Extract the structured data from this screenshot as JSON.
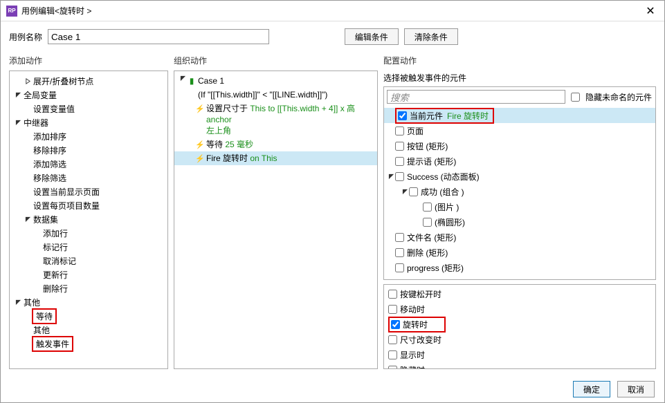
{
  "window": {
    "title": "用例编辑<旋转时 >"
  },
  "top": {
    "name_label": "用例名称",
    "name_value": "Case 1",
    "edit_condition": "编辑条件",
    "clear_condition": "清除条件"
  },
  "panels": {
    "left_title": "添加动作",
    "mid_title": "组织动作",
    "right_title": "配置动作"
  },
  "left_tree": {
    "items": [
      {
        "label": "展开/折叠树节点",
        "indent": 1,
        "toggle": "right"
      },
      {
        "label": "全局变量",
        "indent": 0,
        "toggle": "down"
      },
      {
        "label": "设置变量值",
        "indent": 1
      },
      {
        "label": "中继器",
        "indent": 0,
        "toggle": "down"
      },
      {
        "label": "添加排序",
        "indent": 1
      },
      {
        "label": "移除排序",
        "indent": 1
      },
      {
        "label": "添加筛选",
        "indent": 1
      },
      {
        "label": "移除筛选",
        "indent": 1
      },
      {
        "label": "设置当前显示页面",
        "indent": 1
      },
      {
        "label": "设置每页项目数量",
        "indent": 1
      },
      {
        "label": "数据集",
        "indent": 1,
        "toggle": "down"
      },
      {
        "label": "添加行",
        "indent": 2
      },
      {
        "label": "标记行",
        "indent": 2
      },
      {
        "label": "取消标记",
        "indent": 2
      },
      {
        "label": "更新行",
        "indent": 2
      },
      {
        "label": "删除行",
        "indent": 2
      },
      {
        "label": "其他",
        "indent": 0,
        "toggle": "down"
      },
      {
        "label": "等待",
        "indent": 1,
        "highlight": true
      },
      {
        "label": "其他",
        "indent": 1
      },
      {
        "label": "触发事件",
        "indent": 1,
        "highlight": true
      }
    ]
  },
  "org": {
    "case_label": "Case 1",
    "condition": "(If \"[[This.width]]\" < \"[[LINE.width]]\")",
    "actions": [
      {
        "prefix": "设置尺寸于 ",
        "green": "This to [[This.width + 4]] x 高 anchor 左上角",
        "selected": false,
        "wrap": true
      },
      {
        "prefix": "等待 ",
        "green": "25 毫秒",
        "selected": false
      },
      {
        "prefix": "Fire 旋转时  ",
        "green": "on This",
        "selected": true
      }
    ]
  },
  "right": {
    "select_label": "选择被触发事件的元件",
    "search_placeholder": "搜索",
    "hide_unnamed": "隐藏未命名的元件",
    "widgets": [
      {
        "label": "当前元件",
        "extra": "Fire 旋转时",
        "indent": 0,
        "checked": true,
        "current": true,
        "highlight": true
      },
      {
        "label": "页面",
        "indent": 0
      },
      {
        "label": "按钮 (矩形)",
        "indent": 0
      },
      {
        "label": "提示语 (矩形)",
        "indent": 0
      },
      {
        "label": "Success (动态面板)",
        "indent": 0,
        "toggle": "down"
      },
      {
        "label": "成功 (组合 )",
        "indent": 1,
        "toggle": "down"
      },
      {
        "label": "(图片 )",
        "indent": 2
      },
      {
        "label": "(椭圆形)",
        "indent": 2
      },
      {
        "label": "文件名 (矩形)",
        "indent": 0
      },
      {
        "label": "删除 (矩形)",
        "indent": 0
      },
      {
        "label": "progress (矩形)",
        "indent": 0
      }
    ],
    "events": [
      {
        "label": "按键松开时"
      },
      {
        "label": "移动时"
      },
      {
        "label": "旋转时",
        "checked": true,
        "highlight": true
      },
      {
        "label": "尺寸改变时"
      },
      {
        "label": "显示时"
      },
      {
        "label": "隐藏时"
      }
    ]
  },
  "footer": {
    "ok": "确定",
    "cancel": "取消"
  }
}
